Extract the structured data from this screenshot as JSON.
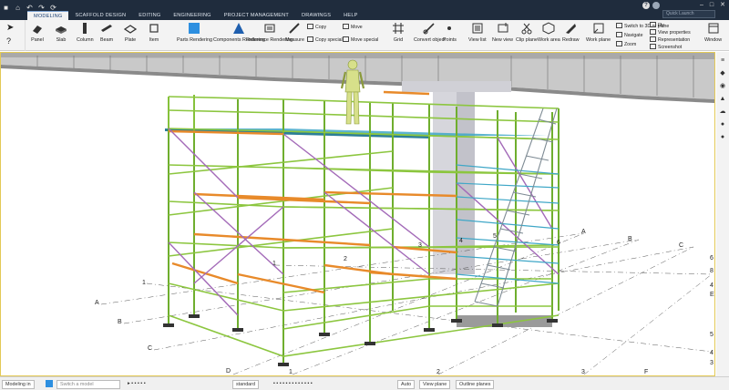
{
  "tabs": [
    "MODELING",
    "SCAFFOLD DESIGN",
    "EDITING",
    "ENGINEERING",
    "PROJECT MANAGEMENT",
    "DRAWINGS",
    "HELP"
  ],
  "active_tab": "MODELING",
  "quick_launch_placeholder": "Quick Launch",
  "ribbon": {
    "panel": "Panel",
    "slab": "Slab",
    "column": "Column",
    "beam": "Beam",
    "plate": "Plate",
    "item": "Item",
    "parts_rendering": "Parts Rendering",
    "components_rendering": "Components Rendering",
    "reference_rendering": "Reference Rendering",
    "measure": "Measure",
    "copy": "Copy",
    "copy_special": "Copy special",
    "move": "Move",
    "move_special": "Move special",
    "grid": "Grid",
    "convert_object": "Convert object",
    "points": "Points",
    "view_list": "View list",
    "new_view": "New view",
    "clip_plane": "Clip plane",
    "work_area": "Work area",
    "redraw": "Redraw",
    "work_plane": "Work plane",
    "switch_3d": "Switch to 3D or plane",
    "navigate": "Navigate",
    "zoom": "Zoom",
    "fly": "Fly",
    "view_properties": "View properties",
    "representation": "Representation",
    "screenshot": "Screenshot",
    "window": "Window"
  },
  "grid_labels": {
    "left": [
      "1",
      "A",
      "B",
      "C"
    ],
    "bottom": [
      "D",
      "1",
      "2",
      "3",
      "F"
    ],
    "right_top": [
      "A",
      "B",
      "C"
    ],
    "right_side": [
      "6",
      "8",
      "4",
      "E",
      "5",
      "4",
      "3"
    ],
    "mid": [
      "1",
      "2",
      "3",
      "4",
      "5",
      "6"
    ]
  },
  "status": {
    "mode": "Modeling in",
    "command": "Switch a model",
    "standard": "standard",
    "auto": "Auto",
    "view_plane": "View plane",
    "outline_planes": "Outline planes"
  },
  "colors": {
    "scaffold_green": "#8cc63f",
    "ledger_orange": "#e88a2a",
    "diagonal_purple": "#a36ab8",
    "deck_teal": "#3fa7c7",
    "bridge_gray": "#8a8a8a",
    "selection_yellow": "#e3c955"
  }
}
